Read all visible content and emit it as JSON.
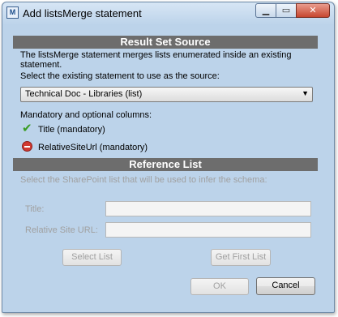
{
  "window": {
    "title": "Add listsMerge statement",
    "icon": "app-document-icon"
  },
  "result_set_source": {
    "header": "Result Set Source",
    "description": "The listsMerge statement merges lists enumerated inside an existing statement.",
    "select_label": "Select the existing statement to use as the source:",
    "selected_statement": "Technical Doc - Libraries (list)",
    "columns_label": "Mandatory and optional columns:",
    "columns": [
      {
        "label": "Title (mandatory)",
        "status": "ok",
        "icon": "check-icon"
      },
      {
        "label": "RelativeSiteUrl (mandatory)",
        "status": "missing",
        "icon": "no-entry-icon"
      }
    ]
  },
  "reference_list": {
    "header": "Reference List",
    "description": "Select the SharePoint list that will be used to infer the schema:",
    "title_label": "Title:",
    "title_value": "",
    "url_label": "Relative Site URL:",
    "url_value": "",
    "select_list_button": "Select List",
    "get_first_list_button": "Get First List"
  },
  "footer": {
    "ok_button": "OK",
    "cancel_button": "Cancel"
  },
  "colors": {
    "section_header_bg": "#6d6d6d",
    "window_frame": "#bcd3ea",
    "check": "#3a9d23",
    "no_entry": "#d13a32"
  }
}
